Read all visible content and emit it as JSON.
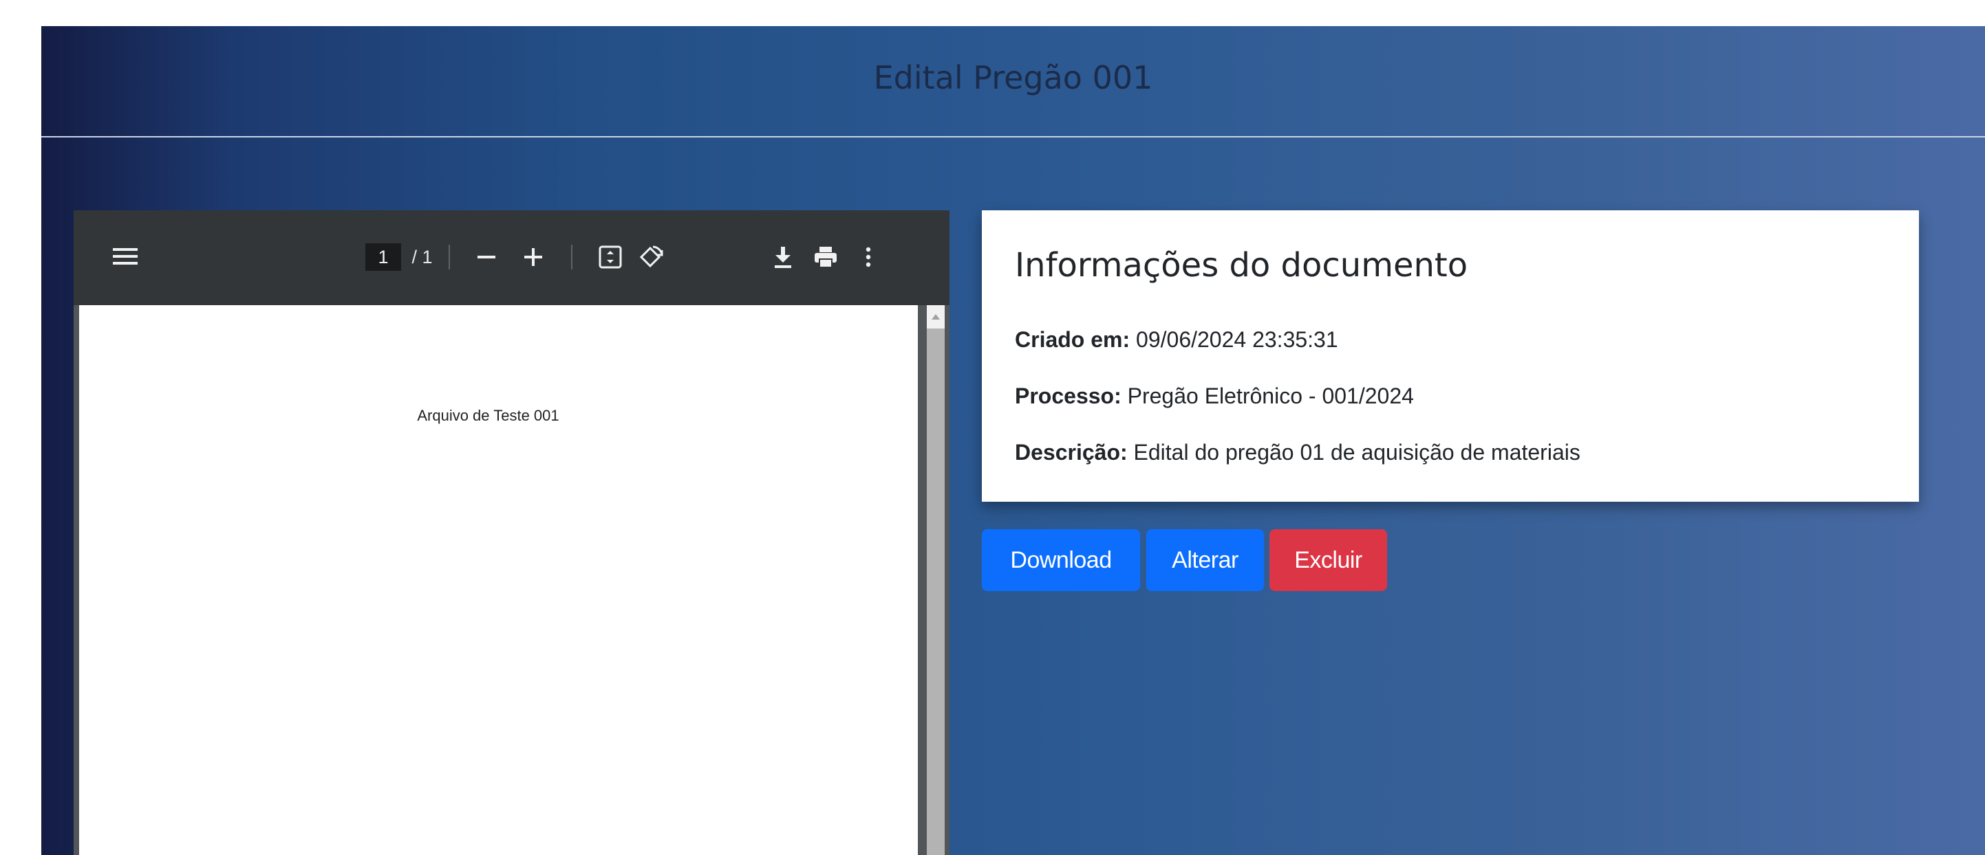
{
  "header": {
    "title": "Edital Pregão 001"
  },
  "viewer": {
    "current_page": "1",
    "page_total_label": " / 1",
    "page_text": "Arquivo de Teste 001",
    "icons": [
      "menu-icon",
      "zoom-out-icon",
      "zoom-in-icon",
      "fit-to-page-icon",
      "rotate-icon",
      "download-icon",
      "print-icon",
      "more-options-icon"
    ]
  },
  "info": {
    "title": "Informações do documento",
    "created_label": "Criado em:",
    "created_value": "09/06/2024 23:35:31",
    "process_label": "Processo:",
    "process_value": "Pregão Eletrônico - 001/2024",
    "description_label": "Descrição:",
    "description_value": "Edital do pregão 01 de aquisição de materiais"
  },
  "actions": {
    "download_label": "Download",
    "alter_label": "Alterar",
    "delete_label": "Excluir"
  },
  "colors": {
    "primary": "#0d6efd",
    "danger": "#dc3545",
    "viewer_toolbar": "#323639"
  }
}
